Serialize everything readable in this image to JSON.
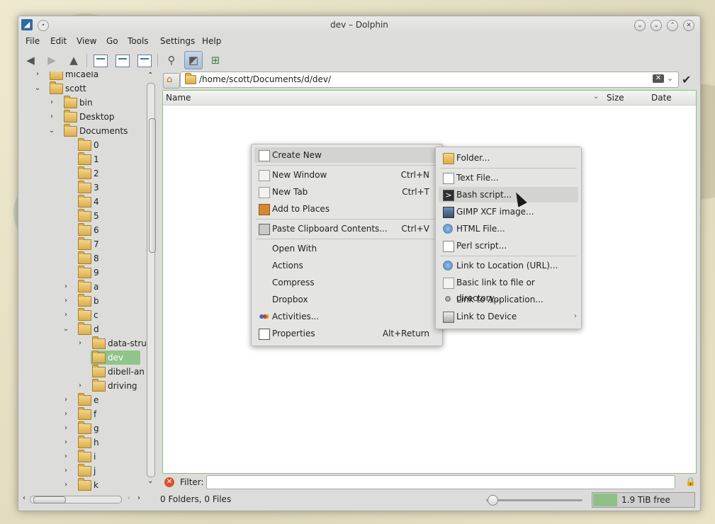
{
  "window": {
    "title": "dev – Dolphin"
  },
  "menubar": [
    "File",
    "Edit",
    "View",
    "Go",
    "Tools",
    "Settings",
    "Help"
  ],
  "tree": [
    {
      "label": "micaela",
      "depth": 1,
      "arrow": "right"
    },
    {
      "label": "scott",
      "depth": 1,
      "arrow": "down"
    },
    {
      "label": "bin",
      "depth": 2,
      "arrow": "right"
    },
    {
      "label": "Desktop",
      "depth": 2,
      "arrow": "right"
    },
    {
      "label": "Documents",
      "depth": 2,
      "arrow": "down"
    },
    {
      "label": "0",
      "depth": 3,
      "arrow": ""
    },
    {
      "label": "1",
      "depth": 3,
      "arrow": ""
    },
    {
      "label": "2",
      "depth": 3,
      "arrow": ""
    },
    {
      "label": "3",
      "depth": 3,
      "arrow": ""
    },
    {
      "label": "4",
      "depth": 3,
      "arrow": ""
    },
    {
      "label": "5",
      "depth": 3,
      "arrow": ""
    },
    {
      "label": "6",
      "depth": 3,
      "arrow": ""
    },
    {
      "label": "7",
      "depth": 3,
      "arrow": ""
    },
    {
      "label": "8",
      "depth": 3,
      "arrow": ""
    },
    {
      "label": "9",
      "depth": 3,
      "arrow": ""
    },
    {
      "label": "a",
      "depth": 3,
      "arrow": "right"
    },
    {
      "label": "b",
      "depth": 3,
      "arrow": "right"
    },
    {
      "label": "c",
      "depth": 3,
      "arrow": "right"
    },
    {
      "label": "d",
      "depth": 3,
      "arrow": "down"
    },
    {
      "label": "data-stru",
      "depth": 4,
      "arrow": "right"
    },
    {
      "label": "dev",
      "depth": 4,
      "arrow": "",
      "selected": true
    },
    {
      "label": "dibell-an",
      "depth": 4,
      "arrow": ""
    },
    {
      "label": "driving",
      "depth": 4,
      "arrow": "right"
    },
    {
      "label": "e",
      "depth": 3,
      "arrow": "right"
    },
    {
      "label": "f",
      "depth": 3,
      "arrow": "right"
    },
    {
      "label": "g",
      "depth": 3,
      "arrow": "right"
    },
    {
      "label": "h",
      "depth": 3,
      "arrow": "right"
    },
    {
      "label": "i",
      "depth": 3,
      "arrow": "right"
    },
    {
      "label": "j",
      "depth": 3,
      "arrow": "right"
    },
    {
      "label": "k",
      "depth": 3,
      "arrow": "right"
    }
  ],
  "location": {
    "path": "/home/scott/Documents/d/dev/"
  },
  "columns": {
    "name": "Name",
    "size": "Size",
    "date": "Date"
  },
  "filter": {
    "label": "Filter:",
    "value": ""
  },
  "status": {
    "text": "0 Folders, 0 Files",
    "free": "1.9 TiB free",
    "used_fraction": 0.24
  },
  "context_menu": [
    {
      "label": "Create New",
      "icon": "new-icon",
      "shortcut": "",
      "submenu": true,
      "highlighted": true
    },
    {
      "sep": true
    },
    {
      "label": "New Window",
      "icon": "window-icon",
      "shortcut": "Ctrl+N"
    },
    {
      "label": "New Tab",
      "icon": "tab-icon",
      "shortcut": "Ctrl+T"
    },
    {
      "label": "Add to Places",
      "icon": "bookmark-icon",
      "shortcut": ""
    },
    {
      "sep": true
    },
    {
      "label": "Paste Clipboard Contents...",
      "icon": "clipboard-icon",
      "shortcut": "Ctrl+V"
    },
    {
      "sep": true
    },
    {
      "label": "Open With",
      "icon": "",
      "shortcut": "",
      "submenu": true
    },
    {
      "label": "Actions",
      "icon": "",
      "shortcut": "",
      "submenu": true
    },
    {
      "label": "Compress",
      "icon": "",
      "shortcut": "",
      "submenu": true
    },
    {
      "label": "Dropbox",
      "icon": "",
      "shortcut": "",
      "submenu": true
    },
    {
      "label": "Activities...",
      "icon": "activities-icon",
      "shortcut": ""
    },
    {
      "label": "Properties",
      "icon": "properties-icon",
      "shortcut": "Alt+Return"
    }
  ],
  "create_new_menu": [
    {
      "label": "Folder...",
      "icon": "folder-icon"
    },
    {
      "sep": true
    },
    {
      "label": "Text File...",
      "icon": "text-file-icon"
    },
    {
      "label": "Bash script...",
      "icon": "terminal-icon",
      "highlighted": true
    },
    {
      "label": "GIMP XCF image...",
      "icon": "image-icon"
    },
    {
      "label": "HTML File...",
      "icon": "globe-icon"
    },
    {
      "label": "Perl script...",
      "icon": "script-icon"
    },
    {
      "sep": true
    },
    {
      "label": "Link to Location (URL)...",
      "icon": "globe-icon"
    },
    {
      "label": "Basic link to file or directory...",
      "icon": "link-icon"
    },
    {
      "label": "Link to Application...",
      "icon": "gear-icon"
    },
    {
      "label": "Link to Device",
      "icon": "drive-icon",
      "submenu": true
    }
  ]
}
